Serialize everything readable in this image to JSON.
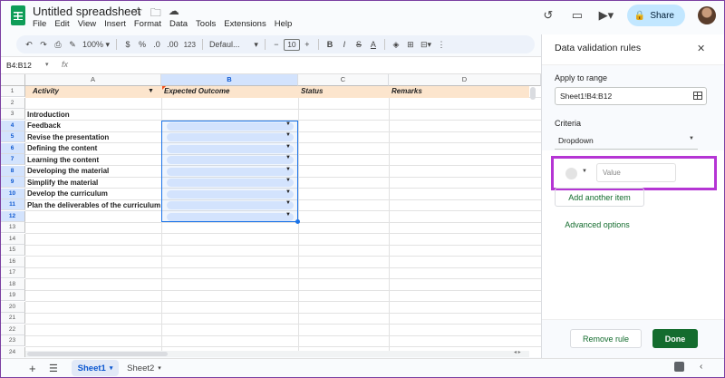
{
  "app": {
    "doc_title": "Untitled spreadsheet",
    "menu": [
      "File",
      "Edit",
      "View",
      "Insert",
      "Format",
      "Data",
      "Tools",
      "Extensions",
      "Help"
    ],
    "share_label": "Share"
  },
  "toolbar": {
    "zoom": "100%",
    "currency": "$",
    "percent": "%",
    "dec_decrease": ".0",
    "dec_increase": ".00",
    "number_format": "123",
    "font": "Defaul...",
    "font_size": "10",
    "bold": "B",
    "italic": "I",
    "strike": "S",
    "text_color": "A"
  },
  "formula_bar": {
    "name_box": "B4:B12",
    "fx": "fx"
  },
  "sheet": {
    "columns": [
      "A",
      "B",
      "C",
      "D"
    ],
    "rows": [
      "1",
      "2",
      "3",
      "4",
      "5",
      "6",
      "7",
      "8",
      "9",
      "10",
      "11",
      "12",
      "13",
      "14",
      "15",
      "16",
      "17",
      "18",
      "19",
      "20",
      "21",
      "22",
      "23",
      "24"
    ],
    "selected_rows": [
      "4",
      "5",
      "6",
      "7",
      "8",
      "9",
      "10",
      "11",
      "12"
    ],
    "header_fill": "#fce5cd",
    "selection_color": "#1a73e8",
    "headers": {
      "a": "Activity",
      "b": "Expected Outcome",
      "c": "Status",
      "d": "Remarks"
    },
    "cells": {
      "a3": "Introduction",
      "a4": "Feedback",
      "a5": "Revise the presentation",
      "a6": "Defining the content",
      "a7": "Learning the content",
      "a8": "Developing the material",
      "a9": "Simplify the material",
      "a10": "Develop the curriculum",
      "a11": "Plan the deliverables of the curriculum"
    }
  },
  "tabs": [
    {
      "label": "Sheet1",
      "active": true
    },
    {
      "label": "Sheet2",
      "active": false
    }
  ],
  "panel": {
    "title": "Data validation rules",
    "apply_label": "Apply to range",
    "range_value": "Sheet1!B4:B12",
    "criteria_label": "Criteria",
    "criteria_value": "Dropdown",
    "value_placeholder": "Value",
    "add_item": "Add another item",
    "advanced": "Advanced options",
    "remove": "Remove rule",
    "done": "Done",
    "highlight_color": "#b535d4",
    "done_color": "#146c2e"
  }
}
